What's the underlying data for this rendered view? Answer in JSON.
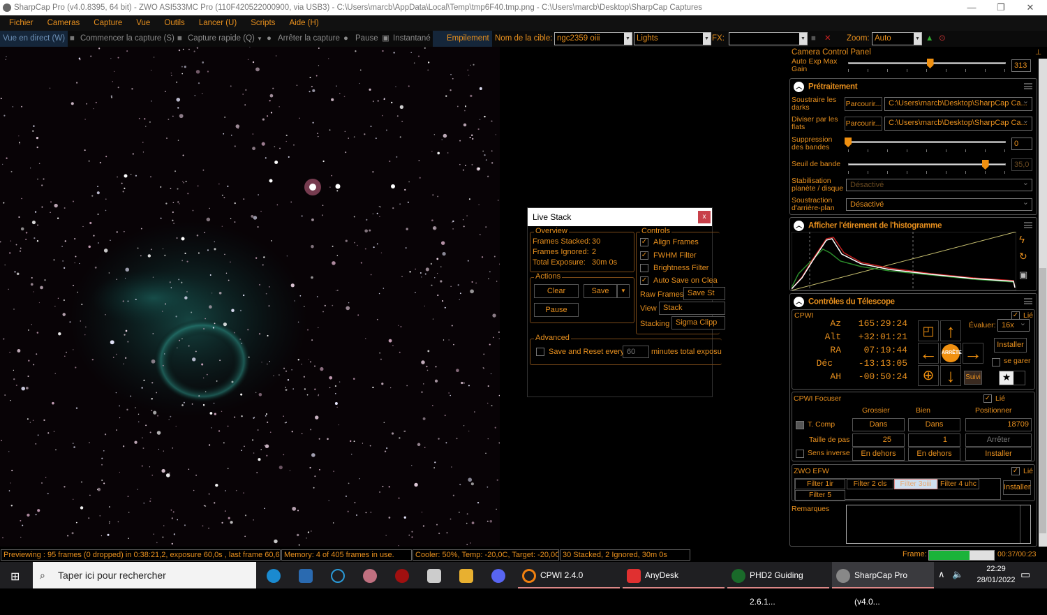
{
  "window": {
    "title": "SharpCap Pro (v4.0.8395, 64 bit) - ZWO ASI533MC Pro (110F420522000900, via USB3) - C:\\Users\\marcb\\AppData\\Local\\Temp\\tmp6F40.tmp.png - C:\\Users\\marcb\\Desktop\\SharpCap Captures",
    "minimize": "—",
    "restore": "❐",
    "close": "✕"
  },
  "menu": [
    "Fichier",
    "Cameras",
    "Capture",
    "Vue",
    "Outils",
    "Lancer (U)",
    "Scripts",
    "Aide (H)"
  ],
  "toolbar": {
    "live_view": "Vue en direct (W)",
    "start_capture": "Commencer la capture (S)",
    "quick_capture": "Capture rapide (Q)",
    "stop_capture": "Arrêter la capture",
    "pause": "Pause",
    "snapshot": "Instantané",
    "stacking": "Empilement",
    "target_label": "Nom de la cible:",
    "target_value": "ngc2359 oiii",
    "frame_type": "Lights",
    "fx_label": "FX:",
    "fx_value": "",
    "zoom_label": "Zoom:",
    "zoom_value": "Auto"
  },
  "camera_panel": {
    "title": "Camera Control Panel",
    "auto_exp_label": "Auto Exp Max Gain",
    "auto_exp_value": "313",
    "auto_exp_fraction": 0.52
  },
  "preprocessing": {
    "title": "Prétraitement",
    "darks_label": "Soustraire les darks",
    "browse": "Parcourir...",
    "darks_path": "C:\\Users\\marcb\\Desktop\\SharpCap Ca...",
    "flats_label": "Diviser par les flats",
    "flats_path": "C:\\Users\\marcb\\Desktop\\SharpCap Ca...",
    "banding_label": "Suppression des bandes",
    "banding_value": "0",
    "threshold_label": "Seuil de bande",
    "threshold_value": "35,0",
    "threshold_fraction": 0.87,
    "planet_label": "Stabilisation planète / disque",
    "planet_value": "Désactivé",
    "background_label": "Soustraction d'arrière-plan",
    "background_value": "Désactivé"
  },
  "histogram": {
    "title": "Afficher l'étirement de l'histogramme"
  },
  "telescope": {
    "title": "Contrôles du Télescope",
    "mount": "CPWI",
    "linked": "Lié",
    "coords": [
      {
        "k": "Az",
        "v": "165:29:24"
      },
      {
        "k": "Alt",
        "v": "+32:01:21"
      },
      {
        "k": "RA",
        "v": "07:19:44"
      },
      {
        "k": "Déc",
        "v": "-13:13:05"
      },
      {
        "k": "AH",
        "v": "-00:50:24"
      }
    ],
    "rate_label": "Évaluer:",
    "rate_value": "16x",
    "setup": "Installer",
    "stop": "ARRÊTE",
    "park": "se garer",
    "tracking": "Suivi"
  },
  "focuser": {
    "title": "CPWI Focuser",
    "linked": "Lié",
    "coarse": "Grossier",
    "fine": "Bien",
    "position": "Positionner",
    "tcomp": "T. Comp",
    "in": "Dans",
    "position_value": "18709",
    "step_label": "Taille de pas",
    "coarse_step": "25",
    "fine_step": "1",
    "halt": "Arrêter",
    "reverse": "Sens inverse",
    "out": "En dehors",
    "setup": "Installer"
  },
  "efw": {
    "title": "ZWO EFW",
    "linked": "Lié",
    "filters": [
      "Filter 1ir",
      "Filter 2 cls",
      "Filter 3oiii",
      "Filter 4 uhc",
      "Filter 5"
    ],
    "active": "Filter 3oiii",
    "setup": "Installer"
  },
  "notes": {
    "label": "Remarques"
  },
  "live_stack": {
    "title": "Live Stack",
    "close": "x",
    "overview": "Overview",
    "frames_stacked_label": "Frames Stacked:",
    "frames_stacked": "30",
    "frames_ignored_label": "Frames Ignored:",
    "frames_ignored": "2",
    "total_exposure_label": "Total Exposure:",
    "total_exposure": "30m 0s",
    "actions": "Actions",
    "clear": "Clear",
    "save": "Save",
    "pause": "Pause",
    "controls": "Controls",
    "align": "Align Frames",
    "fwhm": "FWHM Filter",
    "brightness": "Brightness Filter",
    "autosave": "Auto Save on Clea",
    "raw_label": "Raw Frames",
    "raw_value": "Save St",
    "view_label": "View",
    "view_value": "Stack",
    "stacking_label": "Stacking",
    "stacking_value": "Sigma Clipp",
    "advanced": "Advanced",
    "save_reset": "Save and Reset every",
    "minutes": "60",
    "minutes_suffix": "minutes total exposu"
  },
  "status": {
    "preview": "Previewing : 95 frames (0 dropped) in 0:38:21,2, exposure 60,0s , last frame 60,6s",
    "memory": "Memory: 4 of 405 frames in use.",
    "cooler": "Cooler: 50%, Temp: -20,0C, Target: -20,0C",
    "stack": "30 Stacked, 2 Ignored, 30m 0s",
    "frame_label": "Frame:",
    "frame_progress": 0.62,
    "time": "00:37/00:23"
  },
  "taskbar": {
    "search": "Taper ici pour rechercher",
    "apps": [
      "CPWI 2.4.0",
      "AnyDesk",
      "PHD2 Guiding 2.6.1...",
      "SharpCap Pro (v4.0..."
    ],
    "time": "22:29",
    "date": "28/01/2022"
  }
}
